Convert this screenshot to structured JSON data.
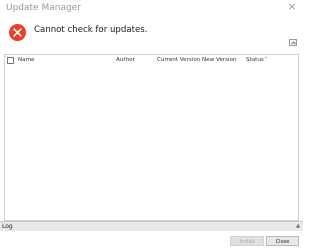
{
  "window": {
    "title": "Update Manager",
    "close_glyph": "×"
  },
  "error": {
    "icon": "error-x-circle-icon",
    "color": "#e8412a",
    "message": "Cannot check for updates."
  },
  "table": {
    "columns": [
      "Name",
      "Author",
      "Current Version",
      "New Version",
      "Status"
    ],
    "sort_glyph": "^",
    "rows": []
  },
  "log": {
    "label": "Log",
    "arrow_glyph": "▲"
  },
  "buttons": {
    "install": "Install",
    "close": "Close"
  }
}
